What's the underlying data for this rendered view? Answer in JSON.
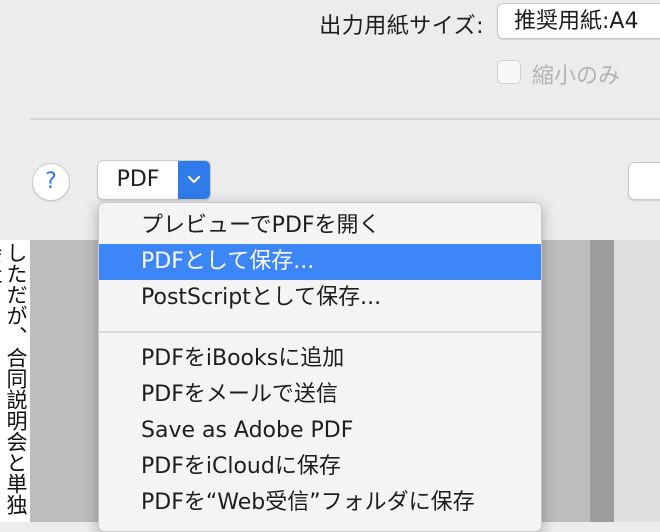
{
  "print_panel": {
    "paper_size_label": "出力用紙サイズ:",
    "paper_size_value": "推奨用紙:A4",
    "shrink_only_label": "縮小のみ",
    "help_label": "?",
    "pdf_button_label": "PDF"
  },
  "pdf_menu": {
    "items": [
      "プレビューでPDFを開く",
      "PDFとして保存...",
      "PostScriptとして保存...",
      "PDFをiBooksに追加",
      "PDFをメールで送信",
      "Save as Adobe PDF",
      "PDFをiCloudに保存",
      "PDFを“Web受信”フォルダに保存"
    ],
    "selected_index": 1
  },
  "preview": {
    "page_text": "しただが、合同説明会と単独会社"
  },
  "colors": {
    "accent": "#2f7bea",
    "selection": "#3c86f7",
    "panel_bg": "#ececec"
  }
}
